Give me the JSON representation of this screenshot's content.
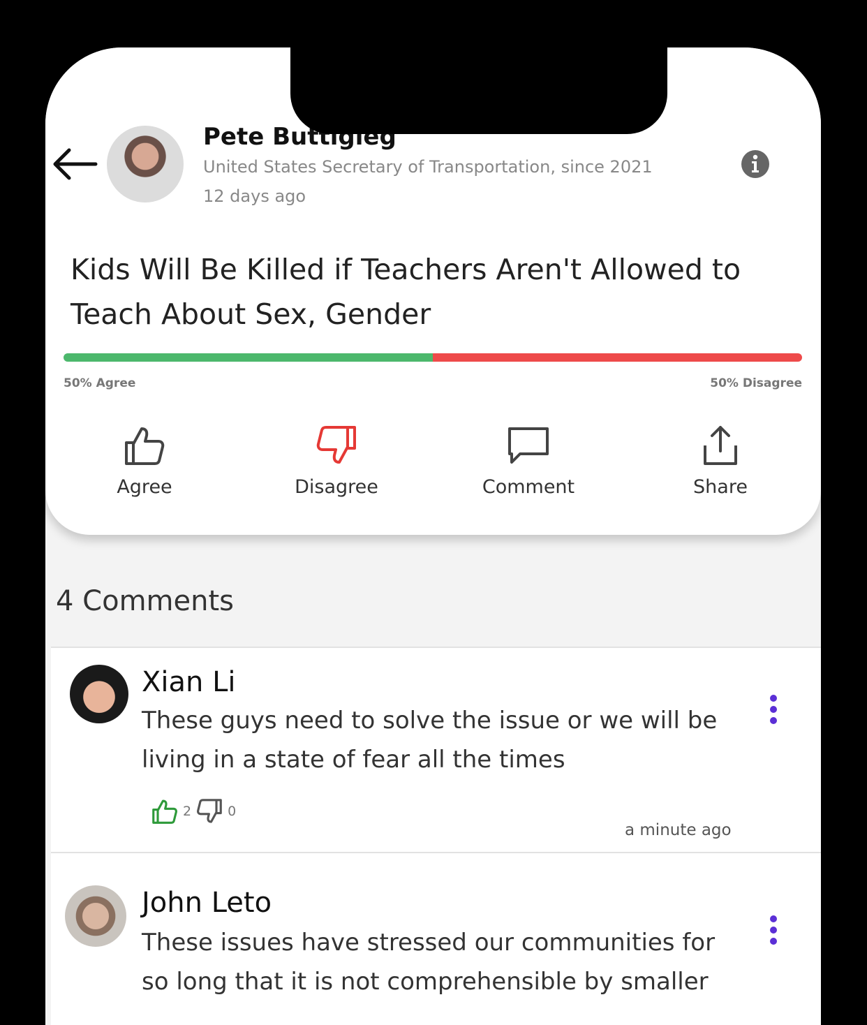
{
  "post": {
    "author_name": "Pete Buttigieg",
    "author_title": "United States Secretary of Transportation, since 2021",
    "posted_time": "12 days ago",
    "headline": "Kids Will Be Killed if Teachers Aren't Allowed to Teach About Sex, Gender",
    "agree_fraction": 0.5,
    "agree_label": "50% Agree",
    "disagree_label": "50% Disagree",
    "colors": {
      "agree": "#4cb86c",
      "disagree": "#ee4a4a"
    }
  },
  "actions": {
    "agree": "Agree",
    "disagree": "Disagree",
    "comment": "Comment",
    "share": "Share"
  },
  "comments_header": "4 Comments",
  "comments": [
    {
      "name": "Xian Li",
      "text": "These guys need to solve the issue or we will be living in a state of fear all the times",
      "likes": "2",
      "dislikes": "0",
      "time": "a minute ago"
    },
    {
      "name": "John Leto",
      "text": "These issues have stressed our communities for so long that it is not comprehensible by smaller"
    }
  ],
  "icons": [
    "back-arrow-icon",
    "info-icon",
    "thumbs-up-icon",
    "thumbs-down-icon",
    "comment-icon",
    "share-icon",
    "more-vertical-icon"
  ],
  "accent_color": "#5b2fd6"
}
